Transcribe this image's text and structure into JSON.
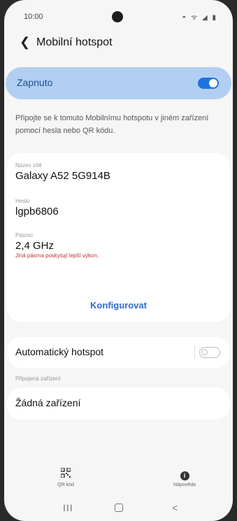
{
  "status_bar": {
    "time": "10:00",
    "icons": "◓ ᯤ ◢ ▮"
  },
  "header": {
    "back_icon": "back-arrow-icon",
    "title": "Mobilní hotspot"
  },
  "toggle": {
    "label": "Zapnuto",
    "state": "on",
    "accent_color": "#1f73e0",
    "card_color": "#b2cff3"
  },
  "description": "Připojte se k tomuto Mobilnímu hotspotu v jiném zařízení pomocí hesla nebo QR kódu.",
  "network": {
    "name_label": "Název sítě",
    "name_value": "Galaxy A52 5G914B",
    "password_label": "Heslo",
    "password_value": "lgpb6806",
    "band_label": "Pásmo",
    "band_value": "2,4 GHz",
    "band_note": "Jiná pásma poskytují lepší výkon."
  },
  "configure_label": "Konfigurovat",
  "auto_hotspot": {
    "label": "Automatický hotspot",
    "state": "off"
  },
  "connected": {
    "section_label": "Připojená zařízení",
    "value": "Žádná zařízení"
  },
  "bottom_tools": {
    "qr_label": "QR kód",
    "help_label": "Nápověda",
    "help_glyph": "i"
  },
  "nav": {
    "recent": "III",
    "back": "<"
  }
}
